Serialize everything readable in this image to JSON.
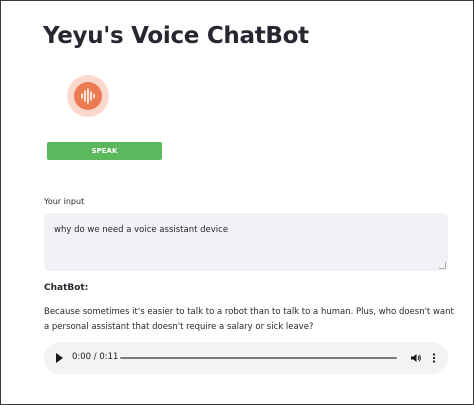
{
  "app": {
    "title": "Yeyu's Voice ChatBot"
  },
  "controls": {
    "speak_label": "SPEAK",
    "mic_icon": "audio-wave-icon"
  },
  "input": {
    "label": "Your input",
    "value": "why do we need a voice assistant device"
  },
  "chatbot": {
    "label": "ChatBot:",
    "response": "Because sometimes it's easier to talk to a robot than to talk to a human. Plus, who doesn't want a personal assistant that doesn't require a salary or sick leave?"
  },
  "audio": {
    "time": "0:00 / 0:11",
    "progress_fraction": 0,
    "play_icon": "play-icon",
    "volume_icon": "volume-icon",
    "more_icon": "more-vertical-icon"
  },
  "colors": {
    "speak_button": "#5cb85c",
    "mic_accent": "#ee7a52",
    "mic_halo": "#f9d9cf",
    "input_background": "#f0f2f6",
    "audio_background": "#f1f3f4"
  }
}
